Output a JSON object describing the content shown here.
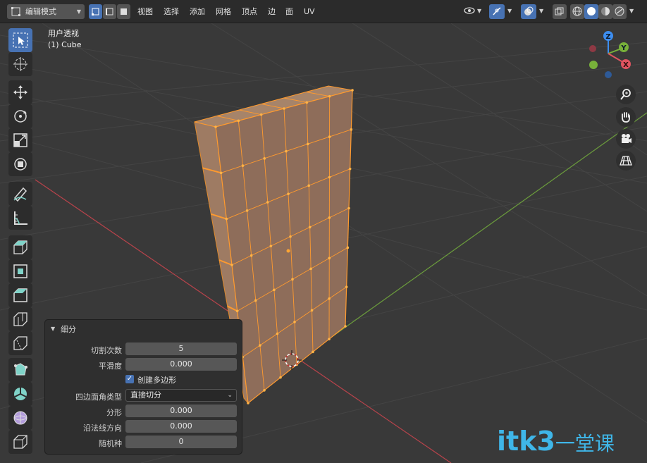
{
  "header": {
    "mode_label": "编辑模式",
    "menu": [
      "视图",
      "选择",
      "添加",
      "网格",
      "顶点",
      "边",
      "面",
      "UV"
    ]
  },
  "viewport": {
    "view_name": "用户透视",
    "object_name": "(1) Cube"
  },
  "gizmo": {
    "x": "X",
    "y": "Y",
    "z": "Z"
  },
  "toolbar_icons": [
    "select-box-icon",
    "cursor-icon",
    "move-icon",
    "rotate-icon",
    "scale-icon",
    "transform-icon",
    "annotate-icon",
    "measure-icon",
    "extrude-icon",
    "inset-icon",
    "bevel-icon",
    "loop-cut-icon",
    "knife-icon",
    "poly-build-icon",
    "spin-icon",
    "smooth-icon",
    "shrink-fatten-icon"
  ],
  "panel": {
    "title": "细分",
    "cuts_label": "切割次数",
    "cuts_value": "5",
    "smooth_label": "平滑度",
    "smooth_value": "0.000",
    "ngon_label": "创建多边形",
    "ngon_checked": true,
    "quad_corner_label": "四边面角类型",
    "quad_corner_value": "直接切分",
    "fractal_label": "分形",
    "fractal_value": "0.000",
    "normal_label": "沿法线方向",
    "normal_value": "0.000",
    "seed_label": "随机种",
    "seed_value": "0"
  },
  "watermark": {
    "main": "itk3",
    "sub": "一堂课"
  },
  "colors": {
    "background": "#393939",
    "grid": "#444444",
    "x_axis": "#b8434b",
    "y_axis": "#6b9c3c",
    "mesh_face": "#8e6d5a",
    "mesh_edge": "#ff9a2e",
    "accent": "#4772b3"
  }
}
